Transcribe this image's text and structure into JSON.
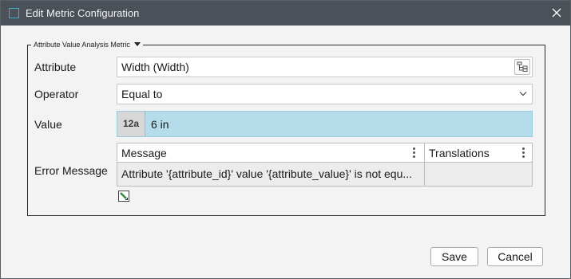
{
  "dialog": {
    "title": "Edit Metric Configuration"
  },
  "group": {
    "legend": "Attribute Value Analysis Metric"
  },
  "form": {
    "attribute_label": "Attribute",
    "attribute_value": "Width (Width)",
    "operator_label": "Operator",
    "operator_value": "Equal to",
    "value_label": "Value",
    "value_type": "12a",
    "value_text": "6 in",
    "error_label": "Error Message"
  },
  "table": {
    "columns": [
      "Message",
      "Translations"
    ],
    "rows": [
      [
        "Attribute '{attribute_id}' value '{attribute_value}' is not equ...",
        ""
      ]
    ]
  },
  "buttons": {
    "save": "Save",
    "cancel": "Cancel"
  },
  "colors": {
    "titlebar": "#4a5158",
    "value_highlight": "#b4dceb",
    "title_icon": "#35b5c9"
  }
}
